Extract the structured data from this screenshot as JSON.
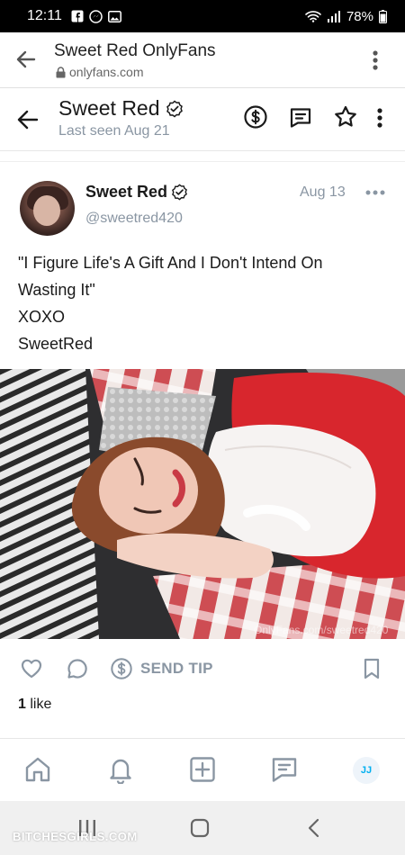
{
  "status_bar": {
    "time": "12:11",
    "battery": "78%"
  },
  "browser": {
    "title": "Sweet Red OnlyFans",
    "url": "onlyfans.com"
  },
  "chat_header": {
    "name": "Sweet Red",
    "last_seen": "Last seen Aug 21"
  },
  "post": {
    "author": "Sweet Red",
    "handle": "@sweetred420",
    "date": "Aug 13",
    "text_lines": [
      "\"I Figure Life's A Gift And I Don't Intend On",
      "Wasting It\"",
      "XOXO",
      "SweetRed"
    ],
    "photo_watermark": "OnlyFans.com/sweetred420",
    "send_tip_label": "SEND TIP",
    "likes_count": "1",
    "likes_label": "like"
  },
  "app_nav": {
    "user_initials": "JJ"
  },
  "watermark": "BITCHESGIRLS.COM",
  "colors": {
    "accent": "#00aff0",
    "muted": "#8a96a3",
    "text": "#1a1a1a"
  }
}
